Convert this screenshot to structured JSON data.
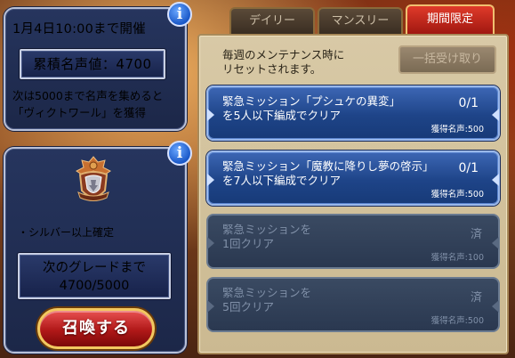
{
  "event": {
    "title": "1月4日10:00まで開催",
    "fame_label": "累積名声値：4700",
    "reward_line1": "次は5000まで名声を集めると",
    "reward_line2": "「ヴィクトワール」を獲得"
  },
  "grade": {
    "silver_note": "・シルバー以上確定",
    "next_grade_label": "次のグレードまで",
    "progress": "4700/5000",
    "summon_button": "召喚する"
  },
  "tabs": [
    {
      "label": "デイリー",
      "active": false
    },
    {
      "label": "マンスリー",
      "active": false
    },
    {
      "label": "期間限定",
      "active": true
    }
  ],
  "panel": {
    "reset_line1": "毎週のメンテナンス時に",
    "reset_line2": "リセットされます。",
    "bulk_receive": "一括受け取り"
  },
  "missions": [
    {
      "line1": "緊急ミッション「プシュケの異変」",
      "line2": "を5人以下編成でクリア",
      "progress": "0/1",
      "reward": "獲得名声:500",
      "state": "active"
    },
    {
      "line1": "緊急ミッション「魔教に降りし夢の啓示」",
      "line2": "を7人以下編成でクリア",
      "progress": "0/1",
      "reward": "獲得名声:500",
      "state": "active"
    },
    {
      "line1": "緊急ミッションを",
      "line2": "1回クリア",
      "progress": "済",
      "reward": "獲得名声:100",
      "state": "done"
    },
    {
      "line1": "緊急ミッションを",
      "line2": "5回クリア",
      "progress": "済",
      "reward": "獲得名声:500",
      "state": "done"
    }
  ],
  "icons": {
    "info": "info-icon",
    "emblem": "silver-crest-emblem"
  },
  "colors": {
    "panel_navy": "#1c2748",
    "mission_blue": "#1e4488",
    "tab_active_red": "#c02818",
    "summon_red": "#b01818"
  }
}
